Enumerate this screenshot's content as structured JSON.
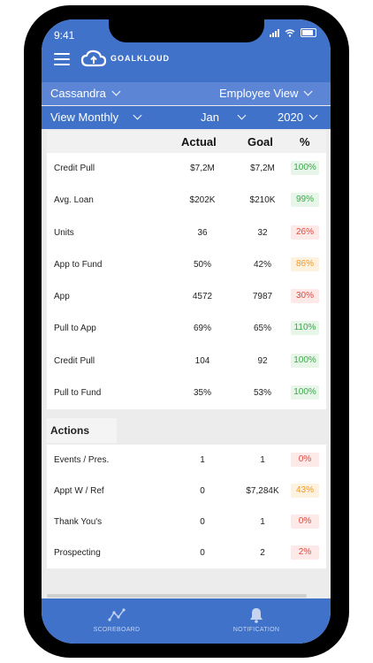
{
  "status_bar": {
    "time": "9:41"
  },
  "app": {
    "logo_text": "GOALKLOUD"
  },
  "selectors": {
    "user": "Cassandra",
    "view": "Employee View",
    "period": "View Monthly",
    "month": "Jan",
    "year": "2020"
  },
  "table_header": {
    "actual": "Actual",
    "goal": "Goal",
    "percent": "%"
  },
  "metrics": [
    {
      "label": "Credit Pull",
      "actual": "$7,2M",
      "goal": "$7,2M",
      "pct": "100%",
      "status": "green"
    },
    {
      "label": "Avg. Loan",
      "actual": "$202K",
      "goal": "$210K",
      "pct": "99%",
      "status": "green"
    },
    {
      "label": "Units",
      "actual": "36",
      "goal": "32",
      "pct": "26%",
      "status": "red"
    },
    {
      "label": "App to Fund",
      "actual": "50%",
      "goal": "42%",
      "pct": "86%",
      "status": "orange"
    },
    {
      "label": "App",
      "actual": "4572",
      "goal": "7987",
      "pct": "30%",
      "status": "red"
    },
    {
      "label": "Pull to App",
      "actual": "69%",
      "goal": "65%",
      "pct": "110%",
      "status": "green"
    },
    {
      "label": "Credit Pull",
      "actual": "104",
      "goal": "92",
      "pct": "100%",
      "status": "green"
    },
    {
      "label": "Pull to Fund",
      "actual": "35%",
      "goal": "53%",
      "pct": "100%",
      "status": "green"
    }
  ],
  "actions": {
    "title": "Actions",
    "rows": [
      {
        "label": "Events / Pres.",
        "actual": "1",
        "goal": "1",
        "pct": "0%",
        "status": "red"
      },
      {
        "label": "Appt W / Ref",
        "actual": "0",
        "goal": "$7,284K",
        "pct": "43%",
        "status": "orange"
      },
      {
        "label": "Thank You's",
        "actual": "0",
        "goal": "1",
        "pct": "0%",
        "status": "red"
      },
      {
        "label": "Prospecting",
        "actual": "0",
        "goal": "2",
        "pct": "2%",
        "status": "red"
      }
    ]
  },
  "tabs": {
    "scoreboard": "SCOREBOARD",
    "notification": "NOTIFICATION"
  },
  "colors": {
    "primary": "#3f72c8",
    "secondary": "#5c85d6",
    "good": "#3aa84a",
    "bad": "#e04a3f",
    "warn": "#ef9a28"
  }
}
